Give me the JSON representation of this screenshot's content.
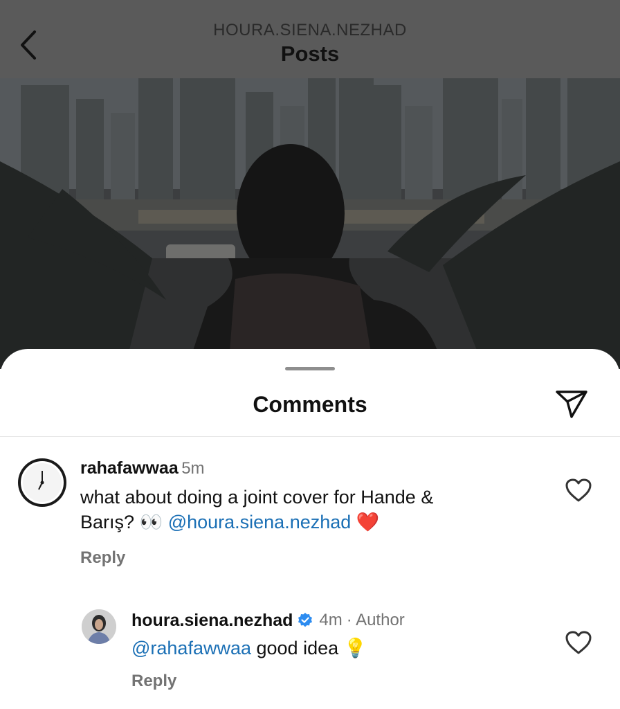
{
  "header": {
    "username": "HOURA.SIENA.NEZHAD",
    "title": "Posts"
  },
  "sheet": {
    "title": "Comments"
  },
  "comments": [
    {
      "username": "rahafawwaa",
      "time": "5m",
      "text_line1": "what about doing a joint cover for Hande &",
      "text_line2_prefix": "Barış? ",
      "emoji_eyes": "👀",
      "mention": "@houra.siena.nezhad",
      "emoji_heart": "❤️",
      "reply_label": "Reply"
    },
    {
      "username": "houra.siena.nezhad",
      "time": "4m",
      "author_label": "· Author",
      "mention": "@rahafawwaa",
      "text": " good idea ",
      "emoji_bulb": "💡",
      "reply_label": "Reply"
    }
  ],
  "colors": {
    "mention": "#1a6fb5",
    "verified": "#2d8cf0",
    "heart": "#e0182d"
  },
  "icons": [
    "back-arrow-icon",
    "paper-plane-icon",
    "heart-outline-icon",
    "verified-badge-icon"
  ]
}
